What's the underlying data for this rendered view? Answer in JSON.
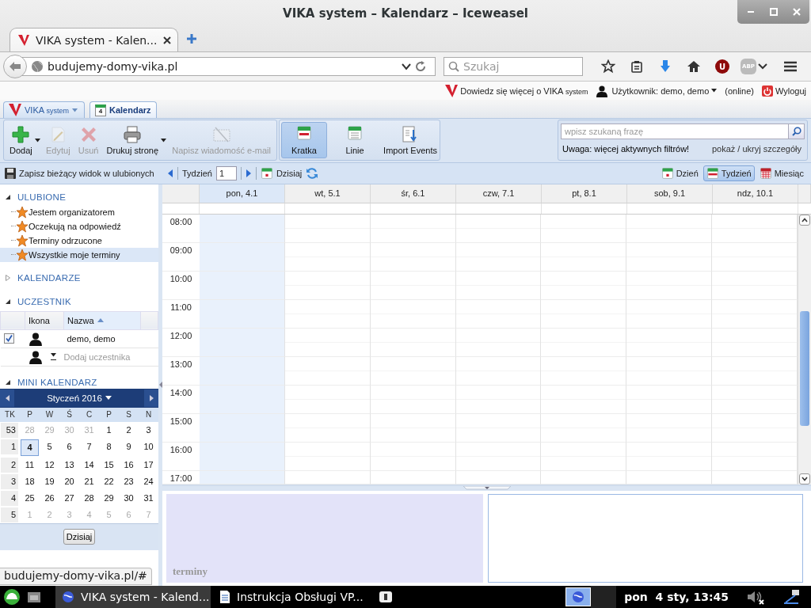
{
  "window": {
    "title": "VIKA system – Kalendarz – Iceweasel"
  },
  "browser_tabs": [
    {
      "label": "VIKA system - Kalen...",
      "selected": true
    }
  ],
  "address_bar": {
    "value": "budujemy-domy-vika.pl"
  },
  "search_bar": {
    "placeholder": "Szukaj"
  },
  "toolbar_badges": [
    "U",
    "ABP"
  ],
  "header": {
    "about_link": "Dowiedz się więcej o VIKA",
    "about_suffix": "system",
    "user": "Użytkownik: demo, demo",
    "status": "(online)",
    "logout": "Wyloguj"
  },
  "app_tabs": [
    {
      "label": "VIKA",
      "suffix": "system",
      "kind": "menu",
      "selected": false
    },
    {
      "label": "Kalendarz",
      "badge": "4",
      "kind": "module",
      "selected": true
    }
  ],
  "toolbar": {
    "actions": [
      {
        "label": "Dodaj",
        "kind": "add",
        "disabled": false,
        "dropdown": true
      },
      {
        "label": "Edytuj",
        "kind": "edit",
        "disabled": true,
        "dropdown": false
      },
      {
        "label": "Usuń",
        "kind": "delete",
        "disabled": true,
        "dropdown": false
      },
      {
        "label": "Drukuj stronę",
        "kind": "print",
        "disabled": false,
        "dropdown": true
      },
      {
        "label": "Napisz wiadomość e-mail",
        "kind": "mail",
        "disabled": true,
        "dropdown": false
      }
    ],
    "views": [
      {
        "label": "Kratka",
        "kind": "grid",
        "selected": true
      },
      {
        "label": "Linie",
        "kind": "lines",
        "selected": false
      },
      {
        "label": "Import Events",
        "kind": "import",
        "selected": false
      }
    ]
  },
  "search": {
    "placeholder": "wpisz szukaną frazę",
    "warning": "Uwaga: więcej aktywnych filtrów!",
    "toggle": "pokaż / ukryj szczegóły"
  },
  "save_view": "Zapisz bieżący widok w ulubionych",
  "week_nav": {
    "label": "Tydzień",
    "value": "1",
    "today": "Dzisiaj"
  },
  "range_buttons": [
    {
      "label": "Dzień",
      "kind": "day",
      "selected": false
    },
    {
      "label": "Tydzień",
      "kind": "week",
      "selected": true
    },
    {
      "label": "Miesiąc",
      "kind": "month",
      "selected": false
    }
  ],
  "sidebar": {
    "favorites": {
      "title": "ULUBIONE",
      "expanded": true,
      "items": [
        {
          "label": "Jestem organizatorem",
          "selected": false
        },
        {
          "label": "Oczekują na odpowiedź",
          "selected": false
        },
        {
          "label": "Terminy odrzucone",
          "selected": false
        },
        {
          "label": "Wszystkie moje terminy",
          "selected": true
        }
      ]
    },
    "calendars": {
      "title": "KALENDARZE",
      "expanded": false
    },
    "participants": {
      "title": "UCZESTNIK",
      "expanded": true,
      "columns": [
        "Ikona",
        "Nazwa"
      ],
      "rows": [
        {
          "name": "demo, demo",
          "checked": true
        }
      ],
      "add_placeholder": "Dodaj uczestnika"
    },
    "mini_calendar": {
      "title": "MINI KALENDARZ",
      "expanded": true,
      "month": "Styczeń 2016",
      "weekdays": [
        "TK",
        "P",
        "W",
        "Ś",
        "C",
        "P",
        "S",
        "N"
      ],
      "weeks": [
        {
          "week": "53",
          "days": [
            {
              "day": "28",
              "other_month": true,
              "selected": false
            },
            {
              "day": "29",
              "other_month": true,
              "selected": false
            },
            {
              "day": "30",
              "other_month": true,
              "selected": false
            },
            {
              "day": "31",
              "other_month": true,
              "selected": false
            },
            {
              "day": "1",
              "other_month": false,
              "selected": false
            },
            {
              "day": "2",
              "other_month": false,
              "selected": false
            },
            {
              "day": "3",
              "other_month": false,
              "selected": false
            }
          ]
        },
        {
          "week": "1",
          "days": [
            {
              "day": "4",
              "other_month": false,
              "selected": true
            },
            {
              "day": "5",
              "other_month": false,
              "selected": false
            },
            {
              "day": "6",
              "other_month": false,
              "selected": false
            },
            {
              "day": "7",
              "other_month": false,
              "selected": false
            },
            {
              "day": "8",
              "other_month": false,
              "selected": false
            },
            {
              "day": "9",
              "other_month": false,
              "selected": false
            },
            {
              "day": "10",
              "other_month": false,
              "selected": false
            }
          ]
        },
        {
          "week": "2",
          "days": [
            {
              "day": "11",
              "other_month": false,
              "selected": false
            },
            {
              "day": "12",
              "other_month": false,
              "selected": false
            },
            {
              "day": "13",
              "other_month": false,
              "selected": false
            },
            {
              "day": "14",
              "other_month": false,
              "selected": false
            },
            {
              "day": "15",
              "other_month": false,
              "selected": false
            },
            {
              "day": "16",
              "other_month": false,
              "selected": false
            },
            {
              "day": "17",
              "other_month": false,
              "selected": false
            }
          ]
        },
        {
          "week": "3",
          "days": [
            {
              "day": "18",
              "other_month": false,
              "selected": false
            },
            {
              "day": "19",
              "other_month": false,
              "selected": false
            },
            {
              "day": "20",
              "other_month": false,
              "selected": false
            },
            {
              "day": "21",
              "other_month": false,
              "selected": false
            },
            {
              "day": "22",
              "other_month": false,
              "selected": false
            },
            {
              "day": "23",
              "other_month": false,
              "selected": false
            },
            {
              "day": "24",
              "other_month": false,
              "selected": false
            }
          ]
        },
        {
          "week": "4",
          "days": [
            {
              "day": "25",
              "other_month": false,
              "selected": false
            },
            {
              "day": "26",
              "other_month": false,
              "selected": false
            },
            {
              "day": "27",
              "other_month": false,
              "selected": false
            },
            {
              "day": "28",
              "other_month": false,
              "selected": false
            },
            {
              "day": "29",
              "other_month": false,
              "selected": false
            },
            {
              "day": "30",
              "other_month": false,
              "selected": false
            },
            {
              "day": "31",
              "other_month": false,
              "selected": false
            }
          ]
        },
        {
          "week": "5",
          "days": [
            {
              "day": "1",
              "other_month": true,
              "selected": false
            },
            {
              "day": "2",
              "other_month": true,
              "selected": false
            },
            {
              "day": "3",
              "other_month": true,
              "selected": false
            },
            {
              "day": "4",
              "other_month": true,
              "selected": false
            },
            {
              "day": "5",
              "other_month": true,
              "selected": false
            },
            {
              "day": "6",
              "other_month": true,
              "selected": false
            },
            {
              "day": "7",
              "other_month": true,
              "selected": false
            }
          ]
        }
      ],
      "today_button": "Dzisiaj"
    }
  },
  "week_view": {
    "days": [
      {
        "label": "pon, 4.1",
        "selected": true
      },
      {
        "label": "wt, 5.1",
        "selected": false
      },
      {
        "label": "śr, 6.1",
        "selected": false
      },
      {
        "label": "czw, 7.1",
        "selected": false
      },
      {
        "label": "pt, 8.1",
        "selected": false
      },
      {
        "label": "sob, 9.1",
        "selected": false
      },
      {
        "label": "ndz, 10.1",
        "selected": false
      }
    ],
    "hours": [
      "08:00",
      "09:00",
      "10:00",
      "11:00",
      "12:00",
      "13:00",
      "14:00",
      "15:00",
      "16:00",
      "17:00"
    ],
    "bottom_label": "terminy"
  },
  "status_url": "budujemy-domy-vika.pl/#",
  "taskbar": {
    "windows": [
      {
        "label": "VIKA system - Kalend...",
        "kind": "browser",
        "selected": true
      },
      {
        "label": "Instrukcja Obsługi VP...",
        "kind": "document",
        "selected": false
      }
    ],
    "clock": "pon  4 sty, 13:45"
  }
}
